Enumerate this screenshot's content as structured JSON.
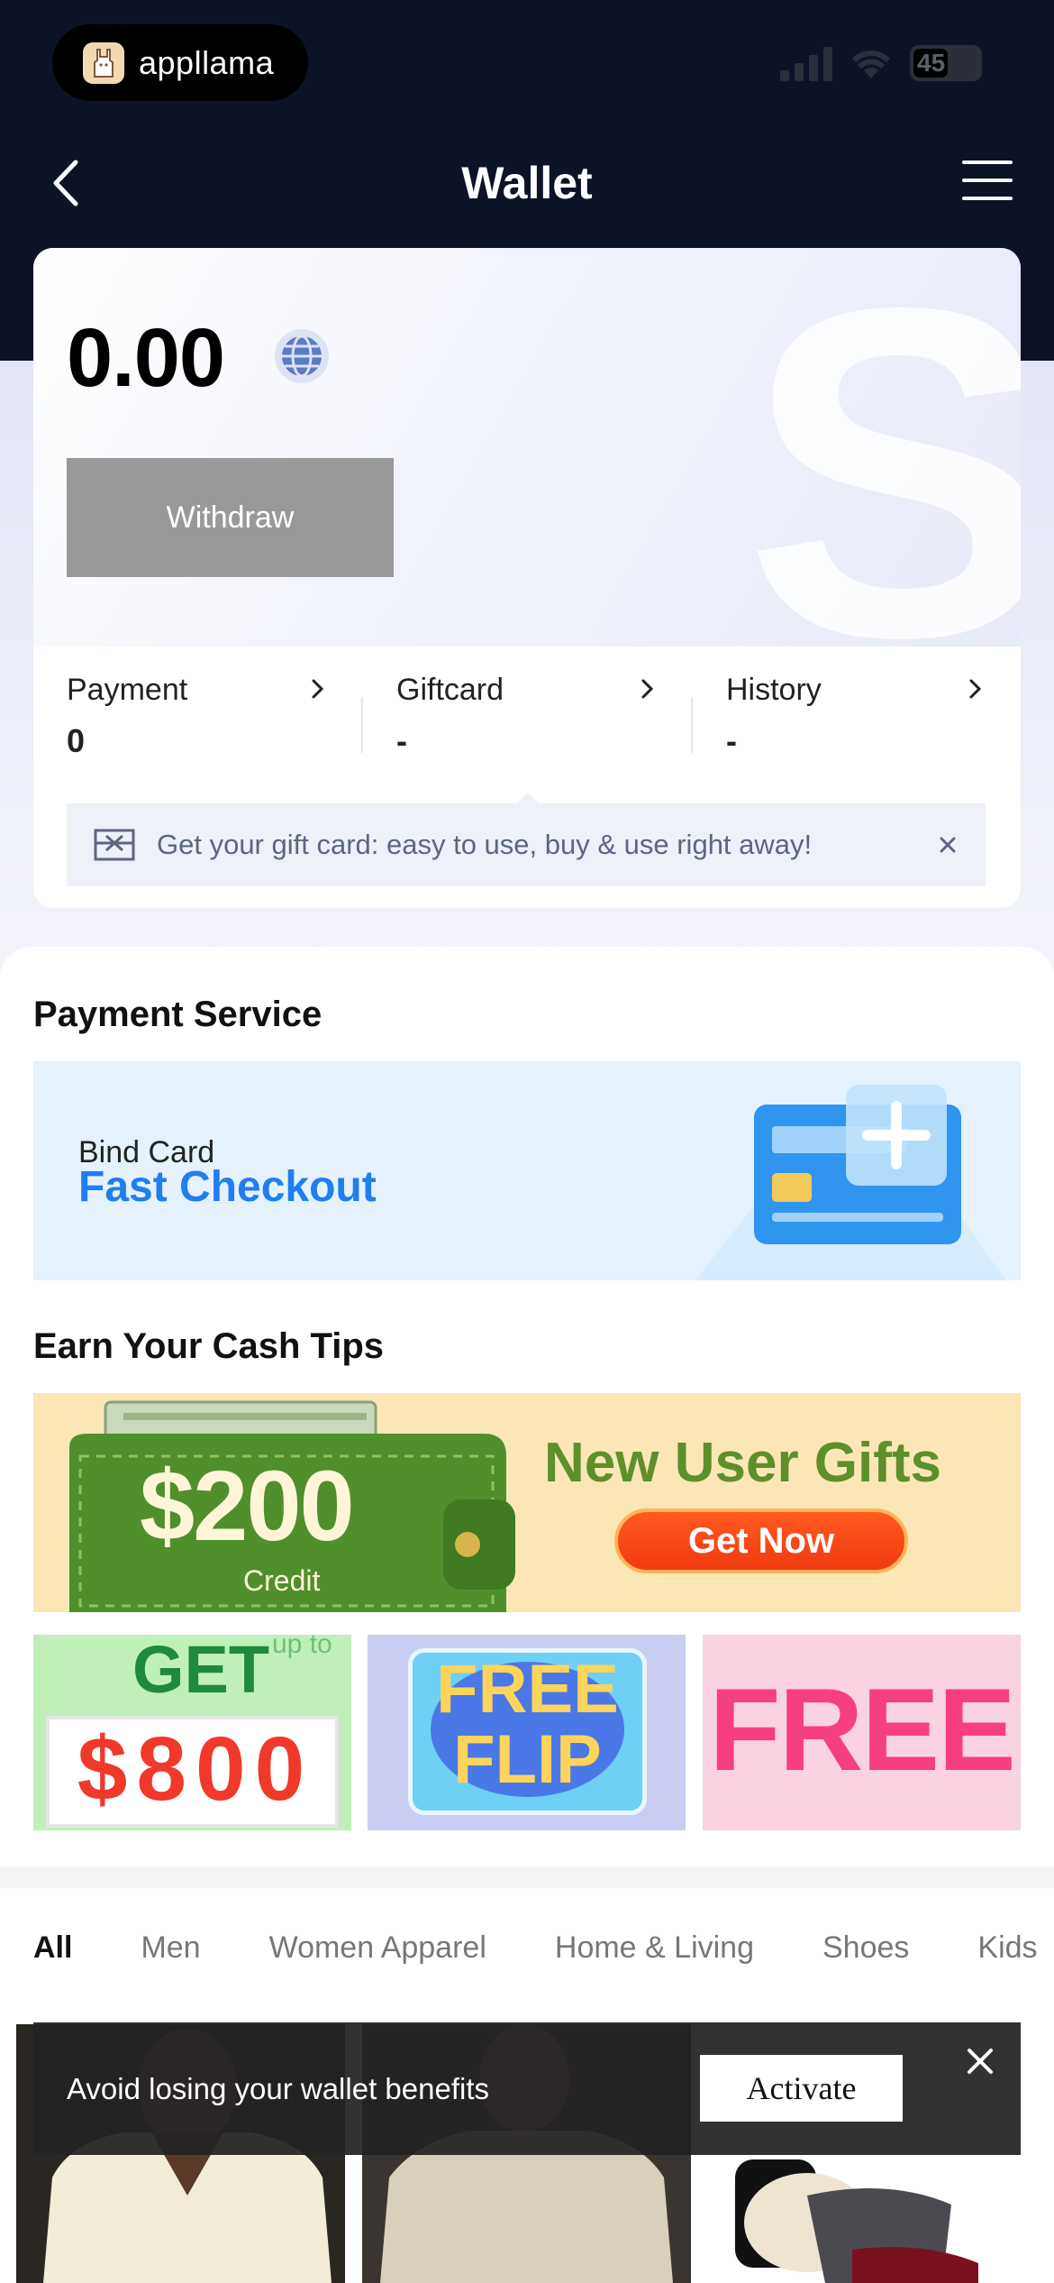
{
  "status_bar": {
    "app_name": "appllama",
    "battery": "45"
  },
  "nav": {
    "title": "Wallet",
    "back_icon": "chevron-left-icon",
    "menu_icon": "hamburger-menu-icon"
  },
  "wallet": {
    "balance": "0.00",
    "globe_icon": "globe-icon",
    "withdraw_label": "Withdraw",
    "stats": [
      {
        "label": "Payment",
        "value": "0"
      },
      {
        "label": "Giftcard",
        "value": "-"
      },
      {
        "label": "History",
        "value": "-"
      }
    ],
    "gift_tip": "Get your gift card: easy to use, buy & use right away!"
  },
  "payment_service": {
    "title": "Payment Service",
    "bind_sub": "Bind Card",
    "bind_main": "Fast Checkout"
  },
  "cash_tips": {
    "title": "Earn Your Cash Tips",
    "banner": {
      "amount": "$200",
      "credit": "Credit",
      "headline": "New User Gifts",
      "cta": "Get Now"
    },
    "promos": [
      {
        "top": "GET",
        "corner": "up to",
        "amount": "$800"
      },
      {
        "line1": "FREE",
        "line2": "FLIP"
      },
      {
        "text": "FREE"
      }
    ]
  },
  "categories": [
    "All",
    "Men",
    "Women Apparel",
    "Home & Living",
    "Shoes",
    "Kids"
  ],
  "toast": {
    "text": "Avoid losing your wallet benefits",
    "cta": "Activate"
  },
  "colors": {
    "header_bg": "#0d1326",
    "accent_blue": "#1f7ef0",
    "withdraw_disabled": "#999999",
    "get_now": "#f23a10"
  }
}
